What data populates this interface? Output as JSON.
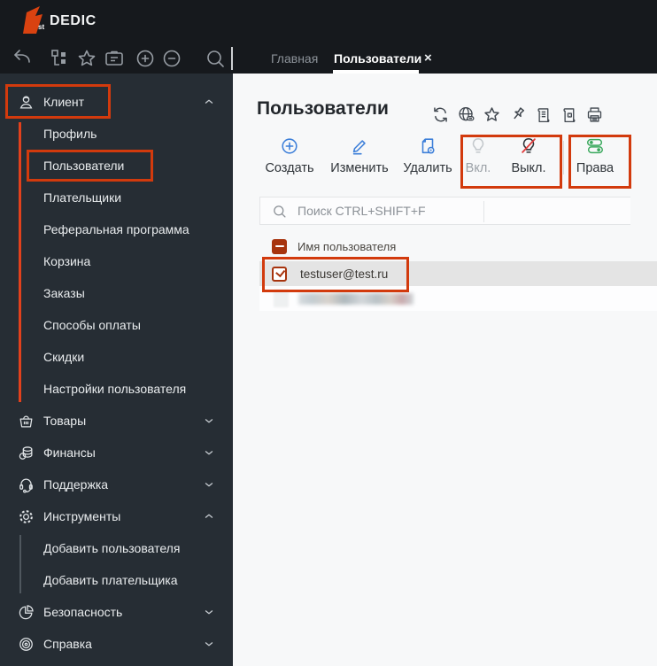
{
  "brand": {
    "logo_prefix": "st",
    "logo_text": "DEDIC"
  },
  "topbar": {
    "quick_icons": [
      "back-arrow-icon",
      "tree-icon",
      "star-icon",
      "tasks-badge-icon",
      "zoom-in-icon",
      "zoom-out-icon",
      "search-icon"
    ],
    "tabs": [
      {
        "label": "Главная",
        "active": false
      },
      {
        "label": "Пользователи",
        "active": true,
        "close": "×"
      }
    ]
  },
  "sidebar": {
    "items": [
      {
        "label": "Клиент",
        "icon": "user-icon",
        "chevron": "up",
        "level": 0
      },
      {
        "label": "Профиль",
        "level": 1
      },
      {
        "label": "Пользователи",
        "level": 1
      },
      {
        "label": "Плательщики",
        "level": 1
      },
      {
        "label": "Реферальная программа",
        "level": 1
      },
      {
        "label": "Корзина",
        "level": 1
      },
      {
        "label": "Заказы",
        "level": 1
      },
      {
        "label": "Способы оплаты",
        "level": 1
      },
      {
        "label": "Скидки",
        "level": 1
      },
      {
        "label": "Настройки пользователя",
        "level": 1
      },
      {
        "label": "Товары",
        "icon": "basket-icon",
        "chevron": "down",
        "level": 0
      },
      {
        "label": "Финансы",
        "icon": "coins-icon",
        "chevron": "down",
        "level": 0
      },
      {
        "label": "Поддержка",
        "icon": "headset-icon",
        "chevron": "down",
        "level": 0
      },
      {
        "label": "Инструменты",
        "icon": "gear-icon",
        "chevron": "up",
        "level": 0
      },
      {
        "label": "Добавить пользователя",
        "level": 1
      },
      {
        "label": "Добавить плательщика",
        "level": 1
      },
      {
        "label": "Безопасность",
        "icon": "pie-chart-icon",
        "chevron": "down",
        "level": 0
      },
      {
        "label": "Справка",
        "icon": "target-icon",
        "chevron": "down",
        "level": 0
      }
    ]
  },
  "content": {
    "title": "Пользователи",
    "title_icons": [
      "refresh-icon",
      "globe-link-icon",
      "star-icon",
      "pin-icon",
      "report-scroll-icon",
      "excel-export-icon",
      "printer-icon"
    ],
    "actions": [
      {
        "label": "Создать",
        "icon": "plus-circle-icon",
        "state": "enabled"
      },
      {
        "label": "Изменить",
        "icon": "pencil-icon",
        "state": "enabled"
      },
      {
        "label": "Удалить",
        "icon": "file-remove-icon",
        "state": "enabled"
      },
      {
        "label": "Вкл.",
        "icon": "bulb-icon",
        "state": "disabled"
      },
      {
        "label": "Выкл.",
        "icon": "bulb-off-icon",
        "state": "enabled"
      },
      {
        "label": "Права",
        "icon": "toggles-icon",
        "state": "enabled"
      }
    ],
    "search": {
      "placeholder": "Поиск CTRL+SHIFT+F"
    },
    "table": {
      "header": "Имя пользователя",
      "rows": [
        {
          "name": "testuser@test.ru",
          "selected": true,
          "checked": true
        },
        {
          "name": "",
          "redacted": true
        }
      ]
    }
  },
  "colors": {
    "annotation_red": "#d23a0d",
    "brand_orange": "#d94210",
    "action_blue": "#3d7fd9",
    "rights_green": "#39a85c",
    "checkbox_red": "#a7340e",
    "topbar_bg": "#16191d",
    "sidebar_bg": "#262d34",
    "selected_row": "#e4e4e4"
  }
}
